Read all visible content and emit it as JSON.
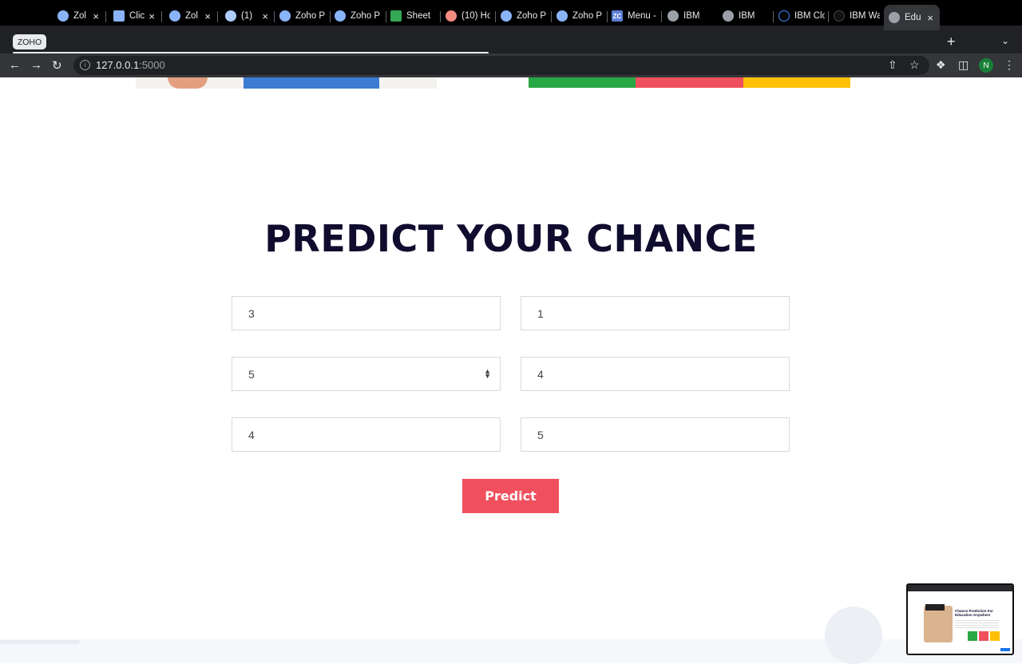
{
  "browser": {
    "zoho_chip": "ZOHO",
    "tabs": [
      {
        "title": "Zol",
        "icon": "zoho-people-icon",
        "close": "×"
      },
      {
        "title": "Clic",
        "icon": "chat-icon",
        "close": "×"
      },
      {
        "title": "Zol",
        "icon": "zoho-people-icon",
        "close": "×"
      },
      {
        "title": "(1)",
        "icon": "mail-icon",
        "close": "×"
      },
      {
        "title": "Zoho P",
        "icon": "zoho-people-icon"
      },
      {
        "title": "Zoho P",
        "icon": "zoho-people-icon"
      },
      {
        "title": "Sheet",
        "icon": "sheet-icon"
      },
      {
        "title": "(10) Ho",
        "icon": "hub-icon"
      },
      {
        "title": "Zoho P",
        "icon": "zoho-people-icon"
      },
      {
        "title": "Zoho P",
        "icon": "zoho-people-icon"
      },
      {
        "title": "Menu -",
        "icon": "zoho-creator-icon",
        "badge": "ZC"
      },
      {
        "title": "IBM",
        "icon": "globe-icon"
      },
      {
        "title": "IBM",
        "icon": "globe-icon"
      },
      {
        "title": "IBM Clo",
        "icon": "ibm-cloud-icon"
      },
      {
        "title": "IBM Wa",
        "icon": "ibm-watson-icon"
      },
      {
        "title": "Edu",
        "icon": "globe-icon",
        "close": "×",
        "active": true
      }
    ],
    "new_tab": "+",
    "tab_menu": "⌄",
    "url_host": "127.0.0.1",
    "url_port": ":5000",
    "profile_initial": "N"
  },
  "page": {
    "heading": "PREDICT YOUR CHANCE",
    "fields": {
      "f1": "3",
      "f2": "1",
      "f3_selected": "5",
      "f4": "4",
      "f5": "4",
      "f6": "5"
    },
    "predict_label": "Predict"
  },
  "colors": {
    "heading": "#0f0c2e",
    "button": "#f0505e",
    "bar_green": "#28a745",
    "bar_red": "#f0505e",
    "bar_yellow": "#ffc107"
  },
  "pip_preview": {
    "title": "Chance Prediction For Education Anywhere"
  }
}
